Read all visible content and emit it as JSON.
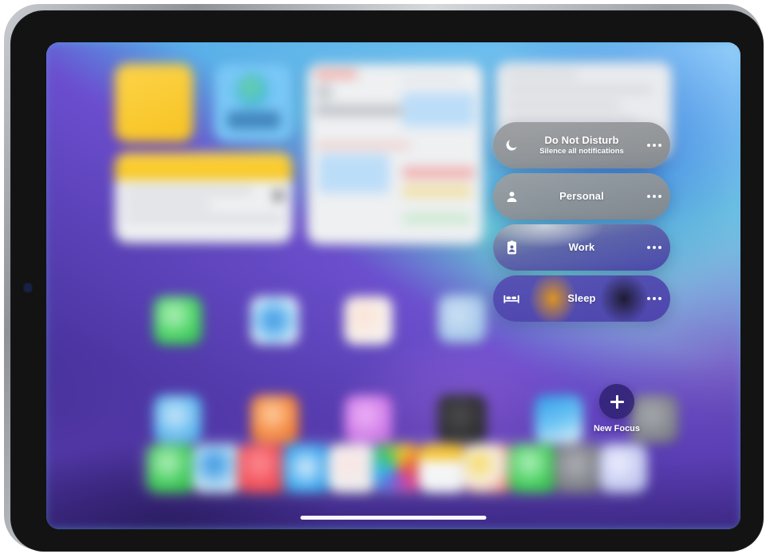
{
  "device": {
    "kind": "tablet",
    "bezel_color": "#131313",
    "frame_color": "#9fa3a8",
    "left_connector_icon": "connector-icon"
  },
  "wallpaper": {
    "name": "abstract-blue-purple-wallpaper",
    "colors": [
      "#4fa7e8",
      "#63c2dd",
      "#6ccfd4",
      "#7b63c8",
      "#4a3594"
    ]
  },
  "homescreen": {
    "blurred": true,
    "widgets": [
      {
        "name": "notes-square-widget",
        "accent": "#f8c320"
      },
      {
        "name": "fitness-square-widget",
        "accent": "#79c7f7"
      },
      {
        "name": "notes-wide-widget",
        "accent": "#f7c517"
      },
      {
        "name": "calendar-widget",
        "accent": "#bcddf8"
      },
      {
        "name": "mail-card-widget",
        "accent": "#e9ebee"
      }
    ],
    "app_rows": [
      [
        {
          "name": "app-icon-messages",
          "color": "#4ad264",
          "glyph": ""
        },
        {
          "name": "app-icon-mail",
          "color": "#e8f3fb",
          "glyph": ""
        },
        {
          "name": "app-icon-photos",
          "color": "#f6f2ee",
          "glyph": ""
        },
        {
          "name": "app-icon-app-store",
          "color": "#e4e9f4",
          "glyph": ""
        }
      ],
      [
        {
          "name": "app-icon-files",
          "color": "#62b9ef",
          "glyph": ""
        },
        {
          "name": "app-icon-music",
          "color": "#f2843c",
          "glyph": ""
        },
        {
          "name": "app-icon-podcasts",
          "color": "#d07ce8",
          "glyph": ""
        },
        {
          "name": "app-icon-settings",
          "color": "#2e2e30",
          "glyph": ""
        },
        {
          "name": "app-icon-weather",
          "color": "#3aa6ef",
          "glyph": ""
        },
        {
          "name": "app-icon-shortcuts",
          "color": "#8c8c96",
          "glyph": ""
        }
      ]
    ],
    "dock": [
      {
        "name": "dock-icon-messages",
        "color": "#3fca59"
      },
      {
        "name": "dock-icon-safari",
        "color": "#d9e3ec"
      },
      {
        "name": "dock-icon-music",
        "color": "#f0515b"
      },
      {
        "name": "dock-icon-mail",
        "color": "#3fa9f0"
      },
      {
        "name": "dock-icon-notes",
        "color": "#eceef0"
      },
      {
        "name": "dock-icon-photos",
        "color": "#f2f3f5"
      },
      {
        "name": "dock-icon-files",
        "color": "#f4f5f6"
      },
      {
        "name": "dock-icon-keynote",
        "color": "#f0f1f3"
      },
      {
        "name": "dock-icon-facetime",
        "color": "#42cc59"
      },
      {
        "name": "dock-icon-settings",
        "color": "#8e9096"
      },
      {
        "name": "dock-icon-freeform",
        "color": "#d7d9ee"
      }
    ],
    "home_indicator": "home-indicator"
  },
  "focus_panel": {
    "name": "focus-control-panel",
    "items": [
      {
        "id": "do-not-disturb",
        "title": "Do Not Disturb",
        "subtitle": "Silence all notifications",
        "icon": "moon-icon",
        "more": "more-options-icon"
      },
      {
        "id": "personal",
        "title": "Personal",
        "subtitle": "",
        "icon": "person-icon",
        "more": "more-options-icon"
      },
      {
        "id": "work",
        "title": "Work",
        "subtitle": "",
        "icon": "id-badge-icon",
        "more": "more-options-icon"
      },
      {
        "id": "sleep",
        "title": "Sleep",
        "subtitle": "",
        "icon": "bed-icon",
        "more": "more-options-icon"
      }
    ],
    "new_focus": {
      "label": "New Focus",
      "icon": "plus-icon"
    }
  }
}
